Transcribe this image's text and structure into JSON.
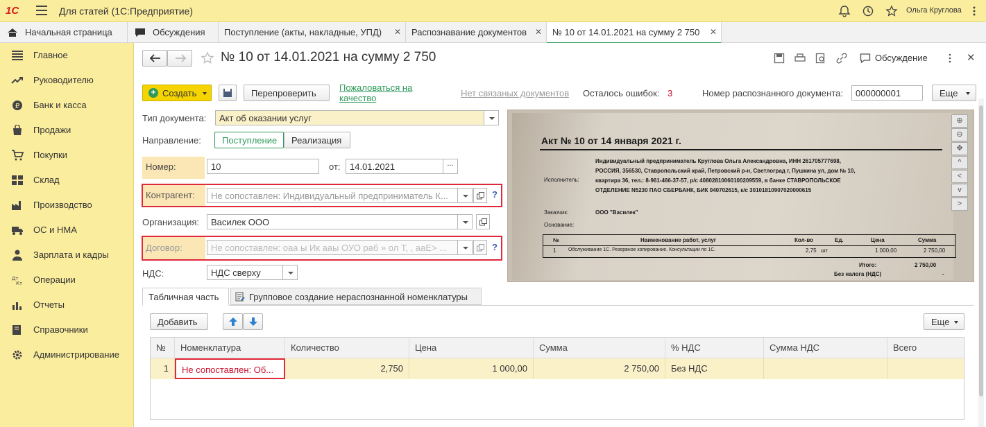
{
  "titlebar": {
    "logo": "1С",
    "app_title": "Для статей  (1С:Предприятие)",
    "user": "Ольга Круглова"
  },
  "tabs": [
    {
      "label": "Начальная страница"
    },
    {
      "label": "Обсуждения"
    },
    {
      "label": "Поступление (акты, накладные, УПД)"
    },
    {
      "label": "Распознавание документов"
    },
    {
      "label": "№ 10 от 14.01.2021 на сумму 2 750"
    }
  ],
  "sidebar": {
    "items": [
      {
        "label": "Главное",
        "icon": "menu-lines-icon"
      },
      {
        "label": "Руководителю",
        "icon": "trend-icon"
      },
      {
        "label": "Банк и касса",
        "icon": "coin-icon"
      },
      {
        "label": "Продажи",
        "icon": "bag-icon"
      },
      {
        "label": "Покупки",
        "icon": "cart-icon"
      },
      {
        "label": "Склад",
        "icon": "grid-icon"
      },
      {
        "label": "Производство",
        "icon": "factory-icon"
      },
      {
        "label": "ОС и НМА",
        "icon": "truck-icon"
      },
      {
        "label": "Зарплата и кадры",
        "icon": "person-icon"
      },
      {
        "label": "Операции",
        "icon": "dt-kt-icon"
      },
      {
        "label": "Отчеты",
        "icon": "bar-chart-icon"
      },
      {
        "label": "Справочники",
        "icon": "book-icon"
      },
      {
        "label": "Администрирование",
        "icon": "gear-icon"
      }
    ]
  },
  "form": {
    "title": "№ 10 от 14.01.2021 на сумму 2 750",
    "discussion_label": "Обсуждение",
    "create_label": "Создать",
    "recheck_label": "Перепроверить",
    "complain_line1": "Пожаловаться на",
    "complain_line2": "качество",
    "no_linked": "Нет связаных документов",
    "errors_label": "Осталось ошибок:",
    "errors_count": "3",
    "recognized_label": "Номер распознанного документа:",
    "recognized_value": "000000001",
    "more_label": "Еще",
    "doc_type_label": "Тип документа:",
    "doc_type_value": "Акт об оказании услуг",
    "direction_label": "Направление:",
    "direction_in": "Поступление",
    "direction_out": "Реализация",
    "number_label": "Номер:",
    "number_value": "10",
    "date_label": "от:",
    "date_value": "14.01.2021",
    "counterparty_label": "Контрагент:",
    "counterparty_value": "Не сопоставлен: Индивидуальный предприниматель К...",
    "org_label": "Организация:",
    "org_value": "Василек ООО",
    "contract_label": "Договор:",
    "contract_value": "Не сопоставлен: оаа ы Ик ааы ОУО раб » ол Т, , ааЕ> ...",
    "vat_label": "НДС:",
    "vat_value": "НДС сверху",
    "help": "?",
    "ellipsis": "..."
  },
  "table_tabs": [
    {
      "label": "Табличная часть"
    },
    {
      "label": "Групповое создание нераспознанной номенклатуры"
    }
  ],
  "table_toolbar": {
    "add_label": "Добавить",
    "more_label": "Еще"
  },
  "table": {
    "columns": [
      "№",
      "Номенклатура",
      "Количество",
      "Цена",
      "Сумма",
      "% НДС",
      "Сумма НДС",
      "Всего"
    ],
    "rows": [
      {
        "n": "1",
        "item": "Не сопоставлен: Об...",
        "qty": "2,750",
        "price": "1 000,00",
        "sum": "2 750,00",
        "vat_rate": "Без НДС",
        "vat_sum": "",
        "total": ""
      }
    ]
  },
  "scan": {
    "heading": "Акт № 10 от 14 января 2021 г.",
    "executor_label": "Исполнитель:",
    "executor_l1": "Индивидуальный предприниматель Круглова Ольга Александровна, ИНН 261705777698,",
    "executor_l2": "РОССИЯ, 356530, Ставропольский край, Петровский р-н, Светлоград г, Пушкина ул, дом № 10,",
    "executor_l3": "квартира 36, тел.: 8-961-466-37-57, р/с 40802810060100209559, в банке СТАВРОПОЛЬСКОЕ",
    "executor_l4": "ОТДЕЛЕНИЕ N5230 ПАО СБЕРБАНК, БИК 040702615, к/с 30101810907020000615",
    "customer_label": "Заказчик:",
    "customer_value": "ООО \"Василек\"",
    "basis_label": "Основание:",
    "cols": [
      "№",
      "Наименование работ, услуг",
      "Кол-во",
      "Ед.",
      "Цена",
      "Сумма"
    ],
    "row": [
      "1",
      "Обслуживание 1С. Резервное копирование. Консультации по 1С.",
      "2,75",
      "шт",
      "1 000,00",
      "2 750,00"
    ],
    "total_label": "Итого:",
    "total_value": "2 750,00",
    "notax_label": "Без налога (НДС)",
    "notax_value": "-"
  }
}
